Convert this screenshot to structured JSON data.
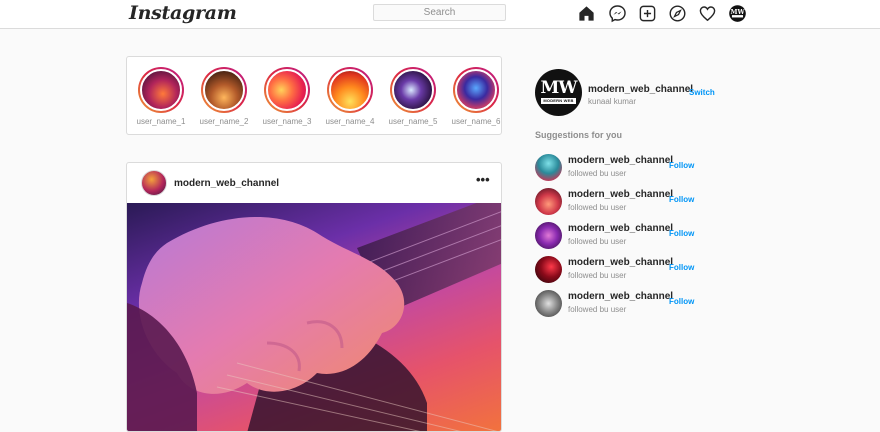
{
  "nav": {
    "logo": "Instagram",
    "search_placeholder": "Search",
    "icons": [
      "home-icon",
      "messenger-icon",
      "new-post-icon",
      "explore-icon",
      "activity-heart-icon",
      "profile-avatar-icon"
    ]
  },
  "stories": [
    {
      "name": "user_name_1"
    },
    {
      "name": "user_name_2"
    },
    {
      "name": "user_name_3"
    },
    {
      "name": "user_name_4"
    },
    {
      "name": "user_name_5"
    },
    {
      "name": "user_name_6"
    }
  ],
  "post": {
    "username": "modern_web_channel",
    "more_icon": "•••"
  },
  "profile": {
    "avatar_text": "MW",
    "avatar_band": "MODERN WEB",
    "username": "modern_web_channel",
    "full_name": "kunaal kumar",
    "switch_label": "Switch"
  },
  "suggestions": {
    "title": "Suggestions for you",
    "items": [
      {
        "name": "modern_web_channel",
        "sub": "followed bu user",
        "action": "Follow"
      },
      {
        "name": "modern_web_channel",
        "sub": "followed bu user",
        "action": "Follow"
      },
      {
        "name": "modern_web_channel",
        "sub": "followed bu user",
        "action": "Follow"
      },
      {
        "name": "modern_web_channel",
        "sub": "followed bu user",
        "action": "Follow"
      },
      {
        "name": "modern_web_channel",
        "sub": "followed bu user",
        "action": "Follow"
      }
    ]
  },
  "colors": {
    "accent": "#0095f6",
    "border": "#dbdbdb",
    "background": "#fafafa"
  }
}
